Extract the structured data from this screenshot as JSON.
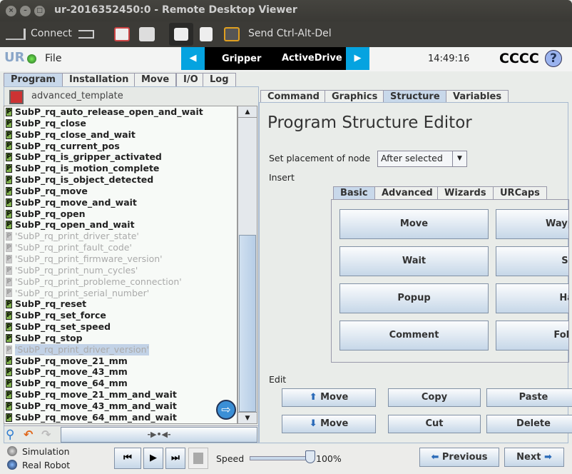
{
  "window": {
    "title": "ur-2016352450:0 - Remote Desktop Viewer"
  },
  "toolbar": {
    "connect": "Connect",
    "send_cad": "Send Ctrl-Alt-Del"
  },
  "header": {
    "file": "File",
    "nav": [
      "Gripper",
      "ActiveDrive"
    ],
    "time": "14:49:16",
    "robot_name": "CCCC",
    "help": "?"
  },
  "main_tabs": [
    "Program",
    "Installation",
    "Move",
    "I/O",
    "Log"
  ],
  "program_name": "advanced_template",
  "program_items": [
    {
      "label": "SubP_rq_auto_release_open_and_wait",
      "state": "normal"
    },
    {
      "label": "SubP_rq_close",
      "state": "normal"
    },
    {
      "label": "SubP_rq_close_and_wait",
      "state": "normal"
    },
    {
      "label": "SubP_rq_current_pos",
      "state": "normal"
    },
    {
      "label": "SubP_rq_is_gripper_activated",
      "state": "normal"
    },
    {
      "label": "SubP_rq_is_motion_complete",
      "state": "normal"
    },
    {
      "label": "SubP_rq_is_object_detected",
      "state": "normal"
    },
    {
      "label": "SubP_rq_move",
      "state": "normal"
    },
    {
      "label": "SubP_rq_move_and_wait",
      "state": "normal"
    },
    {
      "label": "SubP_rq_open",
      "state": "normal"
    },
    {
      "label": "SubP_rq_open_and_wait",
      "state": "normal"
    },
    {
      "label": "'SubP_rq_print_driver_state'",
      "state": "disabled"
    },
    {
      "label": "'SubP_rq_print_fault_code'",
      "state": "disabled"
    },
    {
      "label": "'SubP_rq_print_firmware_version'",
      "state": "disabled"
    },
    {
      "label": "'SubP_rq_print_num_cycles'",
      "state": "disabled"
    },
    {
      "label": "'SubP_rq_print_probleme_connection'",
      "state": "disabled"
    },
    {
      "label": "'SubP_rq_print_serial_number'",
      "state": "disabled"
    },
    {
      "label": "SubP_rq_reset",
      "state": "normal"
    },
    {
      "label": "SubP_rq_set_force",
      "state": "normal"
    },
    {
      "label": "SubP_rq_set_speed",
      "state": "normal"
    },
    {
      "label": "SubP_rq_stop",
      "state": "normal"
    },
    {
      "label": "'SubP_rq_print_driver_version'",
      "state": "selected-disabled"
    },
    {
      "label": "SubP_rq_move_21_mm",
      "state": "normal"
    },
    {
      "label": "SubP_rq_move_43_mm",
      "state": "normal"
    },
    {
      "label": "SubP_rq_move_64_mm",
      "state": "normal"
    },
    {
      "label": "SubP_rq_move_21_mm_and_wait",
      "state": "normal"
    },
    {
      "label": "SubP_rq_move_43_mm_and_wait",
      "state": "normal"
    },
    {
      "label": "SubP_rq_move_64_mm_and_wait",
      "state": "normal"
    }
  ],
  "right_tabs": [
    "Command",
    "Graphics",
    "Structure",
    "Variables"
  ],
  "editor": {
    "title": "Program Structure Editor",
    "placement_label": "Set placement of node",
    "placement_value": "After selected",
    "insert_label": "Insert",
    "insert_tabs": [
      "Basic",
      "Advanced",
      "Wizards",
      "URCaps"
    ],
    "insert_buttons": [
      "Move",
      "Waypoint",
      "Wait",
      "Set",
      "Popup",
      "Halt",
      "Comment",
      "Folder"
    ],
    "edit_label": "Edit",
    "edit_buttons": {
      "move_up": "Move",
      "copy": "Copy",
      "paste": "Paste",
      "move_down": "Move",
      "cut": "Cut",
      "delete": "Delete"
    }
  },
  "bottom": {
    "simulation": "Simulation",
    "real_robot": "Real Robot",
    "speed_label": "Speed",
    "speed_value": "100%",
    "speed_fraction": 1.0,
    "previous": "Previous",
    "next": "Next"
  }
}
